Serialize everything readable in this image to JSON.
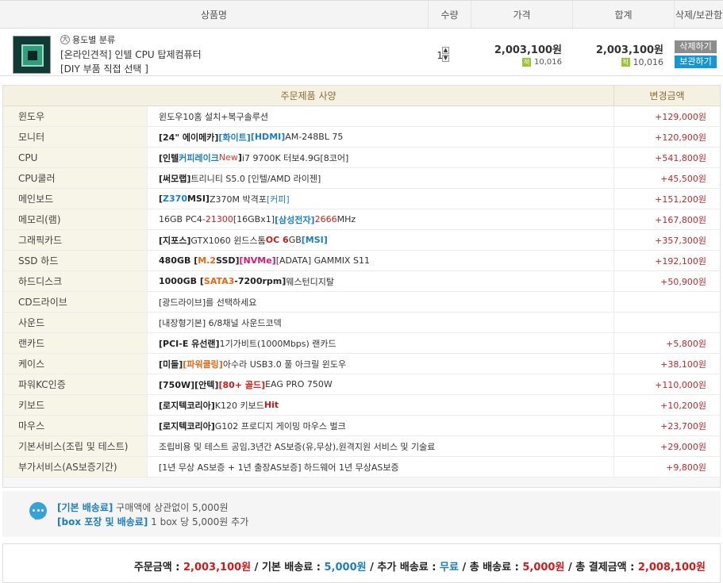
{
  "cart_header": {
    "name": "상품명",
    "qty": "수량",
    "price": "가격",
    "total": "합계",
    "action": "삭제/보관함"
  },
  "product": {
    "category": "용도별 분류",
    "title": "[온라인견적] 인텔 CPU 탑제컴퓨터",
    "subtitle": "[DIY 부품 직접 선택 ]",
    "qty": "1",
    "price": "2,003,100원",
    "price_points": "10,016",
    "total": "2,003,100원",
    "total_points": "10,016",
    "delete_label": "삭제하기",
    "keep_label": "보관하기"
  },
  "spec": {
    "head_main": "주문제품 사양",
    "head_price": "변경금액",
    "rows": [
      {
        "name": "윈도우",
        "price": "+129,000원"
      },
      {
        "name": "모니터",
        "price": "+120,900원"
      },
      {
        "name": "CPU",
        "price": "+541,800원"
      },
      {
        "name": "CPU쿨러",
        "price": "+45,500원"
      },
      {
        "name": "메인보드",
        "price": "+151,200원"
      },
      {
        "name": "메모리(램)",
        "price": "+167,800원"
      },
      {
        "name": "그래픽카드",
        "price": "+357,300원"
      },
      {
        "name": "SSD 하드",
        "price": "+192,100원"
      },
      {
        "name": "하드디스크",
        "price": "+50,900원"
      },
      {
        "name": "CD드라이브",
        "price": ""
      },
      {
        "name": "사운드",
        "price": ""
      },
      {
        "name": "랜카드",
        "price": "+5,800원"
      },
      {
        "name": "케이스",
        "price": "+38,100원"
      },
      {
        "name": "파워KC인증",
        "price": "+110,000원"
      },
      {
        "name": "키보드",
        "price": "+10,200원"
      },
      {
        "name": "마우스",
        "price": "+23,700원"
      },
      {
        "name": "기본서비스(조립 및 테스트)",
        "price": "+29,000원"
      },
      {
        "name": "부가서비스(AS보증기간)",
        "price": "+9,800원"
      }
    ],
    "values": {
      "r0": {
        "a": "윈도우10홈 설치+복구솔루션"
      },
      "r1": {
        "a": "[24\" 에이메카]",
        "b": "[화이트]",
        "c": "[HDMI]",
        "d": " AM-248BL 75"
      },
      "r2": {
        "a": "[인텔 ",
        "b": "커피레이크",
        "c": "New",
        "d": "]",
        "e": " i7 9700K 터보4.9G[8코어]"
      },
      "r3": {
        "a": "[써모랩]",
        "b": " 트리니티 S5.0 [인텔/AMD 라이젠]"
      },
      "r4": {
        "a": "[",
        "b": "Z370",
        "c": " MSI]",
        "d": " Z370M 박격포 ",
        "e": "[커피]"
      },
      "r5": {
        "a": "16GB PC4-",
        "b": "21300",
        "c": " [16GBx1] ",
        "d": "[삼성전자]",
        "e": " ",
        "f": "2666",
        "g": "MHz"
      },
      "r6": {
        "a": "[지포스]",
        "b": " GTX1060 윈드스톰 ",
        "c": "OC 6",
        "d": "GB ",
        "e": "[MSI]"
      },
      "r7": {
        "a": "480GB [",
        "b": "M.2",
        "c": " SSD]",
        "d": "[NVMe]",
        "e": " [ADATA] GAMMIX S11"
      },
      "r8": {
        "a": "1000GB [",
        "b": "SATA3",
        "c": "-7200rpm]",
        "d": " 웨스턴디지탈"
      },
      "r9": {
        "a": "[광드라이브]를 선택하세요"
      },
      "r10": {
        "a": "[내장형기본] 6/8채널 사운드코덱"
      },
      "r11": {
        "a": "[PCI-E 유선랜]",
        "b": " 1기가비트(1000Mbps) 랜카드"
      },
      "r12": {
        "a": "[미들]",
        "b": "[파워쿨링]",
        "c": " 아수라 USB3.0 풀 아크릴 윈도우"
      },
      "r13": {
        "a": "[750W][안텍]",
        "b": "[80+ 골드]",
        "c": " EAG PRO 750W"
      },
      "r14": {
        "a": "[로지텍코리아]",
        "b": " K120 키보드 ",
        "c": "Hit"
      },
      "r15": {
        "a": "[로지텍코리아]",
        "b": " G102 프로디지 게이밍 마우스 벌크"
      },
      "r16": {
        "a": "조립비용 및 테스트 공임,3년간 AS보증(유,무상),원격지원 서비스 및 기술료"
      },
      "r17": {
        "a": "[1년 무상 AS보증 + 1년 출장AS보증] 하드웨어 1년 무상AS보증"
      }
    }
  },
  "shipping": {
    "basic_label": "[기본 배송료]",
    "basic_text": " 구매액에 상관없이 5,000원",
    "box_label": "[box 포장 및 배송료]",
    "box_text": " 1 box 당 5,000원 추가"
  },
  "summary": {
    "order_label": "주문금액 : ",
    "order_value": "2,003,100원",
    "sep1": " / ",
    "basic_label": "기본 배송료 : ",
    "basic_value": "5,000원",
    "sep2": " / ",
    "extra_label": "추가 배송료 : ",
    "extra_value": "무료",
    "sep3": " / ",
    "ship_label": "총 배송료 : ",
    "ship_value": "5,000원",
    "sep4": " / ",
    "pay_label": "총 결제금액 : ",
    "pay_value": "2,008,100원"
  },
  "colors": {
    "accent_blue": "#1d7ec2",
    "accent_red": "#d11b1b",
    "spec_header_bg": "#f4f1e3",
    "spec_label_bg": "#f7f4e8"
  }
}
